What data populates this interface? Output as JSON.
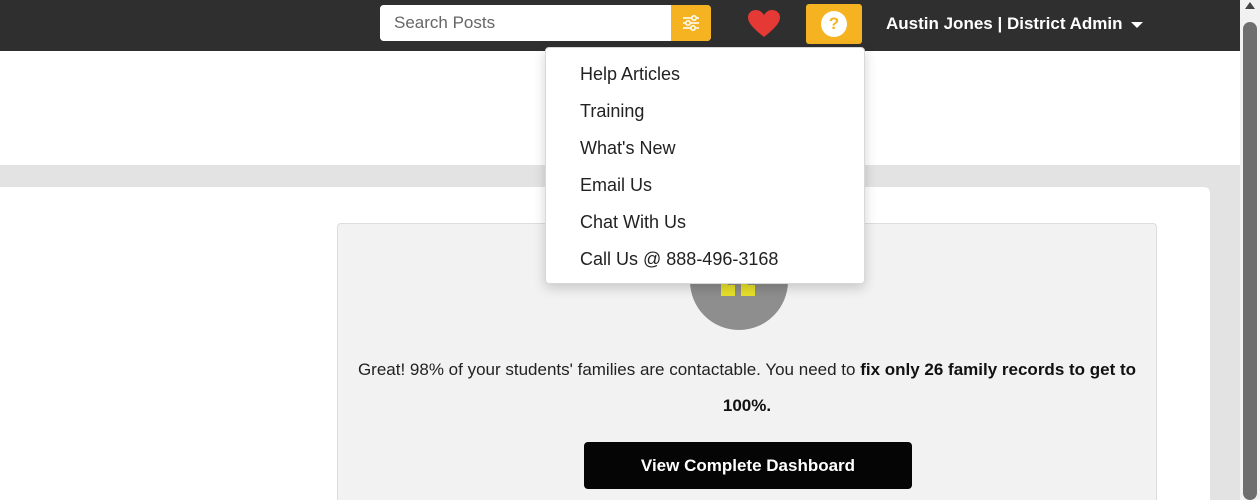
{
  "header": {
    "search": {
      "placeholder": "Search Posts",
      "value": ""
    },
    "user_menu_label": "Austin Jones | District Admin",
    "help_icon_glyph": "?"
  },
  "help_menu": {
    "items": [
      {
        "label": "Help Articles"
      },
      {
        "label": "Training"
      },
      {
        "label": "What's New"
      },
      {
        "label": "Email Us"
      },
      {
        "label": "Chat With Us"
      },
      {
        "label": "Call Us @ 888-496-3168"
      }
    ]
  },
  "nudge": {
    "message_part1": "Great! 98% of your students' families are contactable. You need to ",
    "message_bold1": "fix only 26 family records",
    "message_part2": " to get to 100%.",
    "button_label": "View Complete Dashboard"
  },
  "colors": {
    "topbar": "#2f2f2f",
    "accent": "#f5b321",
    "heart": "#e53935",
    "quote_mark": "#e8e12a",
    "button": "#050505"
  },
  "icons": [
    "filter-sliders-icon",
    "heart-icon",
    "help-icon",
    "chevron-down-icon",
    "quote-icon"
  ]
}
